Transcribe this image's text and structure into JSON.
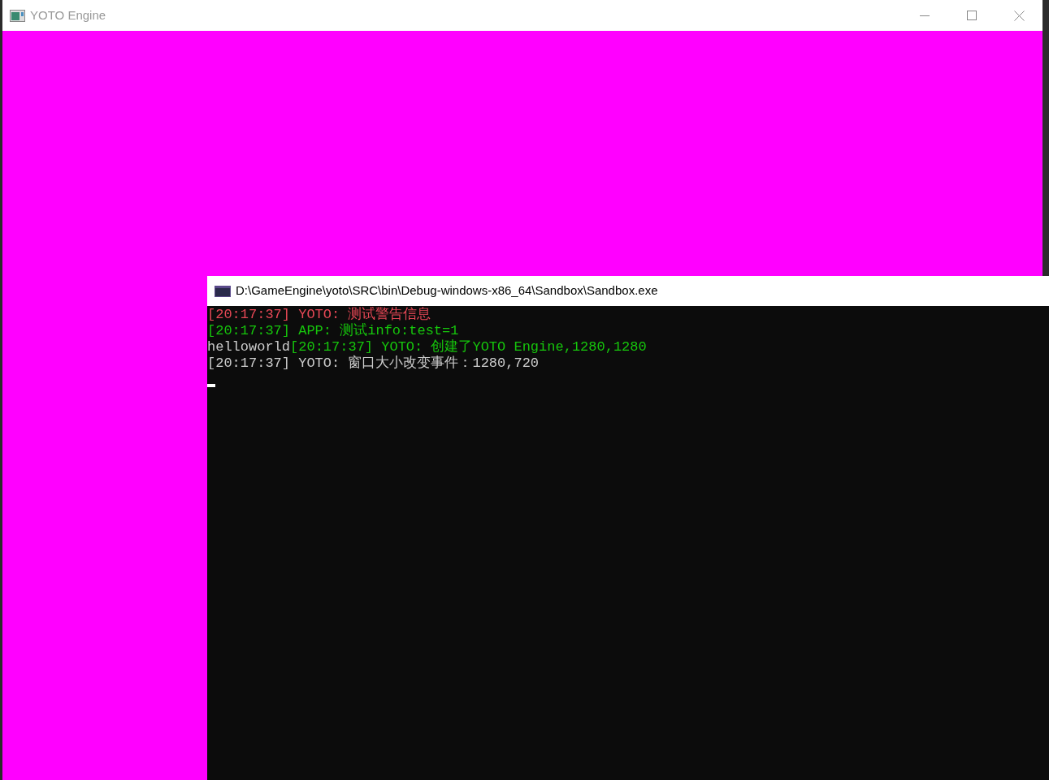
{
  "main_window": {
    "title": "YOTO Engine"
  },
  "console_window": {
    "title": "D:\\GameEngine\\yoto\\SRC\\bin\\Debug-windows-x86_64\\Sandbox\\Sandbox.exe",
    "lines": [
      {
        "segments": [
          {
            "kind": "warn",
            "text": "[20:17:37] YOTO: 测试警告信息"
          }
        ]
      },
      {
        "segments": [
          {
            "kind": "info",
            "text": "[20:17:37] APP: 测试info:test=1"
          }
        ]
      },
      {
        "segments": [
          {
            "kind": "plain",
            "text": "helloworld"
          },
          {
            "kind": "info",
            "text": "[20:17:37] YOTO: 创建了YOTO Engine,1280,1280"
          }
        ]
      },
      {
        "segments": [
          {
            "kind": "plain",
            "text": "[20:17:37] YOTO: 窗口大小改变事件：1280,720"
          }
        ]
      }
    ]
  }
}
